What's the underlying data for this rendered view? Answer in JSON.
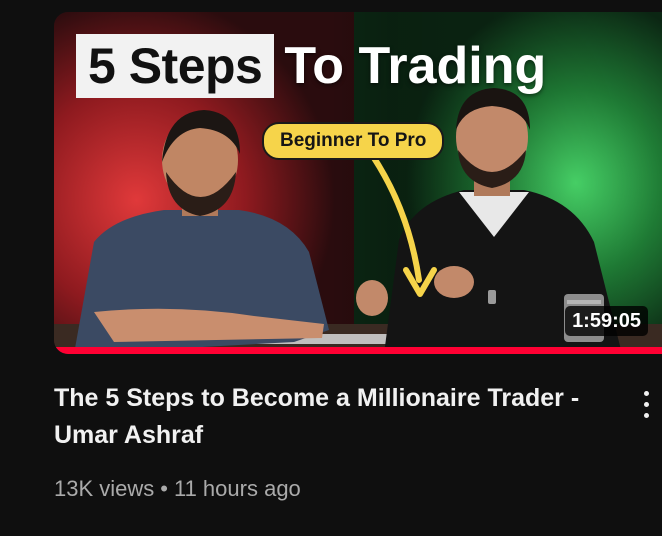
{
  "thumbnail": {
    "headline_boxed": "5 Steps",
    "headline_rest": "To Trading",
    "pill_label": "Beginner To Pro",
    "duration": "1:59:05",
    "watched_fraction": 1.0,
    "colors": {
      "left_glow": "#c8242a",
      "right_glow": "#2fb64a",
      "pill": "#f6d44a",
      "progress": "#ff0033"
    }
  },
  "video": {
    "title": "The 5 Steps to Become a Millionaire Trader - Umar Ashraf",
    "views": "13K views",
    "separator": "•",
    "age": "11 hours ago"
  },
  "icons": {
    "menu": "more-vertical-icon"
  }
}
